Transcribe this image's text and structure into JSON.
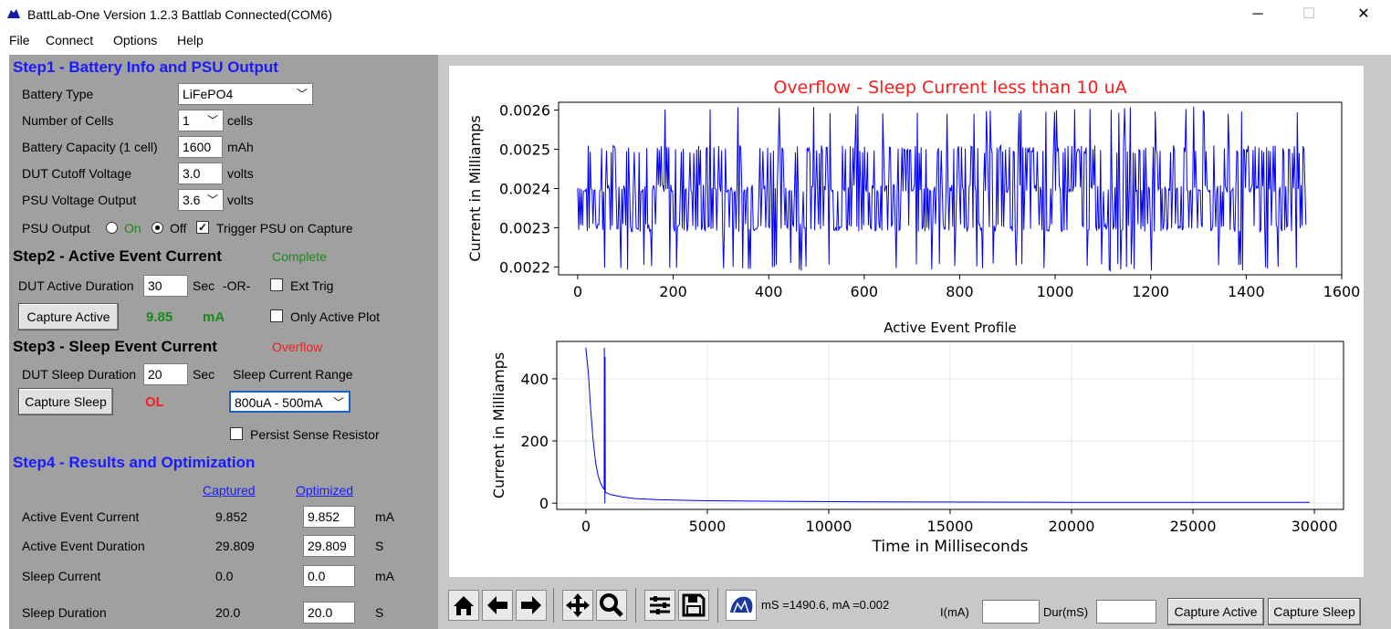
{
  "window": {
    "title": "BattLab-One Version 1.2.3    Battlab Connected(COM6)",
    "controls": [
      "─",
      "☐",
      "✕"
    ]
  },
  "menu": [
    "File",
    "Connect",
    "Options",
    "Help"
  ],
  "step1": {
    "heading": "Step1 - Battery Info and PSU Output",
    "battery_type_label": "Battery Type",
    "battery_type_value": "LiFePO4",
    "cells_label": "Number of Cells",
    "cells_value": "1",
    "cells_unit": "cells",
    "capacity_label": "Battery Capacity (1 cell)",
    "capacity_value": "1600",
    "capacity_unit": "mAh",
    "cutoff_label": "DUT Cutoff Voltage",
    "cutoff_value": "3.0",
    "cutoff_unit": "volts",
    "psu_voltage_label": "PSU Voltage Output",
    "psu_voltage_value": "3.6",
    "psu_voltage_unit": "volts",
    "psu_output_label": "PSU Output",
    "on_label": "On",
    "off_label": "Off",
    "trigger_label": "Trigger PSU on Capture"
  },
  "step2": {
    "heading": "Step2 - Active Event Current",
    "status": "Complete",
    "duration_label": "DUT Active Duration",
    "duration_value": "30",
    "sec_label": "Sec",
    "or_label": "-OR-",
    "ext_trig_label": "Ext Trig",
    "capture_button": "Capture Active",
    "current_value": "9.85",
    "current_unit": "mA",
    "only_active_label": "Only Active Plot"
  },
  "step3": {
    "heading": "Step3 - Sleep Event Current",
    "status": "Overflow",
    "duration_label": "DUT Sleep Duration",
    "duration_value": "20",
    "sec_label": "Sec",
    "range_label": "Sleep Current Range",
    "range_value": "800uA - 500mA",
    "capture_button": "Capture Sleep",
    "current_value": "OL",
    "persist_label": "Persist Sense Resistor"
  },
  "step4": {
    "heading": "Step4 - Results and Optimization",
    "captured_header": "Captured",
    "optimized_header": "Optimized",
    "rows": [
      {
        "label": "Active Event Current",
        "captured": "9.852",
        "optimized": "9.852",
        "unit": "mA"
      },
      {
        "label": "Active Event Duration",
        "captured": "29.809",
        "optimized": "29.809",
        "unit": "S"
      },
      {
        "label": "Sleep Current",
        "captured": "0.0",
        "optimized": "0.0",
        "unit": "mA"
      },
      {
        "label": "Sleep Duration",
        "captured": "20.0",
        "optimized": "20.0",
        "unit": "S"
      }
    ]
  },
  "toolbar": {
    "icons": [
      "home-icon",
      "back-icon",
      "forward-icon",
      "pan-icon",
      "zoom-icon",
      "configure-icon",
      "save-icon",
      "battlab-logo-icon"
    ],
    "coords": "mS =1490.6, mA =0.002",
    "i_label": "I(mA)",
    "i_value": "",
    "dur_label": "Dur(mS)",
    "dur_value": "",
    "capture_active": "Capture Active",
    "capture_sleep": "Capture Sleep"
  },
  "colors": {
    "panel": "#a0a0a0",
    "blue_heading": "#1a1aff",
    "ok_green": "#1a8a1a",
    "error_red": "#ff1a1a",
    "plot_line": "#0000ff"
  },
  "chart_data": [
    {
      "type": "line",
      "title": "Overflow - Sleep Current less than 10 uA",
      "title_color": "#ff1a1a",
      "xlabel": "",
      "ylabel": "Current in Milliamps",
      "xlim": [
        -40,
        1600
      ],
      "ylim": [
        0.00218,
        0.00262
      ],
      "xticks": [
        0,
        200,
        400,
        600,
        800,
        1000,
        1200,
        1400,
        1600
      ],
      "xtick_labels": [
        "0",
        "200",
        "400",
        "600",
        "800",
        "1000",
        "1200",
        "1400",
        "1600"
      ],
      "yticks": [
        0.0022,
        0.0023,
        0.0024,
        0.0025,
        0.0026
      ],
      "ytick_labels": [
        "0.0022",
        "0.0023",
        "0.0024",
        "0.0025",
        "0.0026"
      ],
      "grid": false,
      "series": [
        {
          "color": "#0000ff",
          "x_range": [
            0,
            1525
          ],
          "y_levels": [
            0.0022,
            0.0023,
            0.0024,
            0.0025,
            0.0026
          ],
          "y_mean": 0.0024,
          "n_points": 760
        }
      ]
    },
    {
      "type": "line",
      "title": "Active Event Profile",
      "xlabel": "Time in Milliseconds",
      "ylabel": "Current in Milliamps",
      "xlim": [
        -1200,
        31200
      ],
      "ylim": [
        -20,
        520
      ],
      "xticks": [
        0,
        5000,
        10000,
        15000,
        20000,
        25000,
        30000
      ],
      "xtick_labels": [
        "0",
        "5000",
        "10000",
        "15000",
        "20000",
        "25000",
        "30000"
      ],
      "yticks": [
        0,
        200,
        400
      ],
      "ytick_labels": [
        "0",
        "200",
        "400"
      ],
      "grid": true,
      "series": [
        {
          "color": "#0000ff",
          "x": [
            0,
            100,
            200,
            300,
            400,
            500,
            600,
            700,
            750,
            760,
            780,
            790,
            800,
            1000,
            1500,
            2000,
            3000,
            5000,
            8000,
            12000,
            20000,
            29800
          ],
          "y": [
            500,
            420,
            300,
            200,
            130,
            90,
            65,
            50,
            45,
            500,
            0,
            470,
            35,
            28,
            20,
            15,
            11,
            8,
            6,
            4,
            3,
            3
          ]
        }
      ]
    }
  ]
}
